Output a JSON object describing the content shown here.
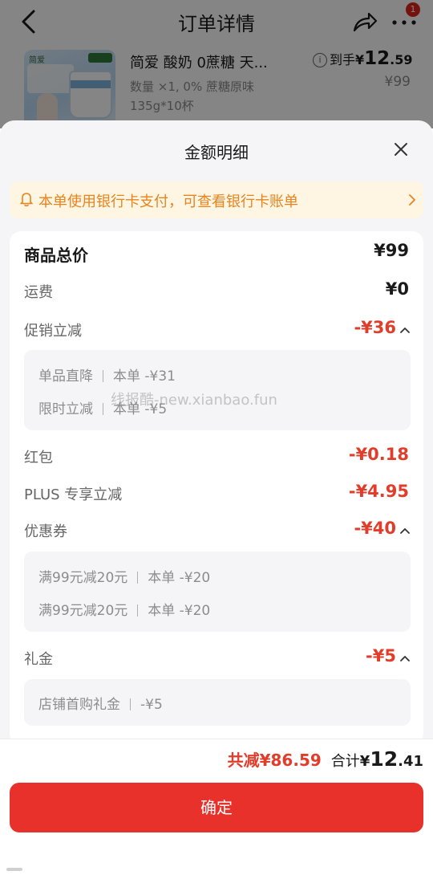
{
  "nav": {
    "title": "订单详情",
    "badge": "1"
  },
  "product": {
    "name": "简爱 酸奶 0蔗糖 天...",
    "spec": "数量 ×1, 0% 蔗糖原味135g*10杯",
    "thumb_brand": "简爱",
    "price_label": "到手",
    "price_currency": "¥",
    "price_int": "12",
    "price_dec": ".59",
    "original_price": "¥99"
  },
  "sheet": {
    "title": "金额明细",
    "banner": "本单使用银行卡支付，可查看银行卡账单",
    "rows": {
      "total": {
        "label": "商品总价",
        "value": "¥99"
      },
      "shipping": {
        "label": "运费",
        "value": "¥0"
      },
      "promo": {
        "label": "促销立减",
        "value": "-¥36",
        "items": [
          {
            "name": "单品直降",
            "detail": "本单 -¥31"
          },
          {
            "name": "限时立减",
            "detail": "本单 -¥5"
          }
        ]
      },
      "redpacket": {
        "label": "红包",
        "value": "-¥0.18"
      },
      "plus": {
        "label": "PLUS 专享立减",
        "value": "-¥4.95"
      },
      "coupon": {
        "label": "优惠券",
        "value": "-¥40",
        "items": [
          {
            "name": "满99元减20元",
            "detail": "本单 -¥20"
          },
          {
            "name": "满99元减20元",
            "detail": "本单 -¥20"
          }
        ]
      },
      "gift": {
        "label": "礼金",
        "value": "-¥5",
        "items": [
          {
            "name": "店铺首购礼金",
            "detail": "-¥5"
          }
        ]
      }
    },
    "watermark": "线报酷-new.xianbao.fun"
  },
  "footer": {
    "saved": "共减¥86.59",
    "total_label": "合计",
    "total_currency": "¥",
    "total_int": "12",
    "total_dec": ".41",
    "confirm": "确定"
  },
  "colors": {
    "accent": "#e8312a",
    "price_red": "#e23c2a",
    "banner_text": "#e8841e",
    "banner_bg": "#fef5e3"
  }
}
